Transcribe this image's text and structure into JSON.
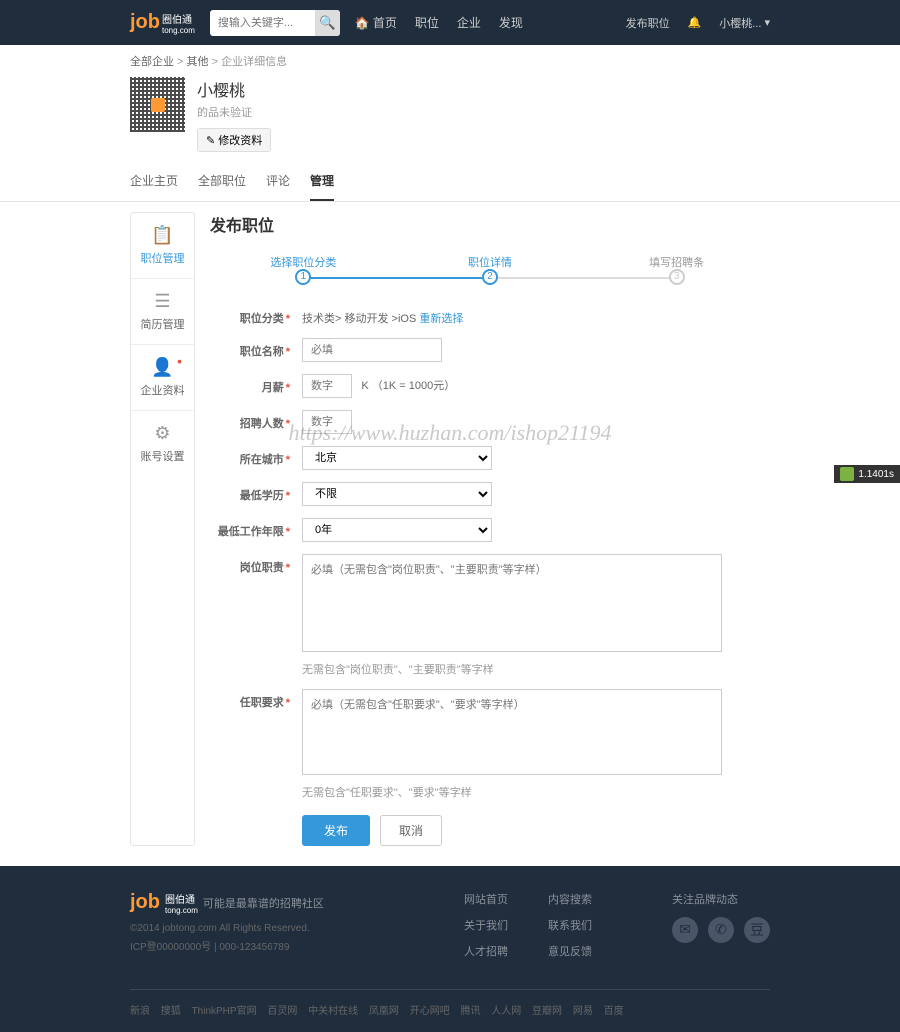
{
  "header": {
    "logo": "job",
    "logo_sub": "圈伯通",
    "logo_domain": "tong.com",
    "search_placeholder": "搜输入关键字...",
    "nav": [
      {
        "label": "首页"
      },
      {
        "label": "职位"
      },
      {
        "label": "企业"
      },
      {
        "label": "发现"
      }
    ],
    "right": {
      "publish": "发布职位",
      "username": "小樱桃..."
    }
  },
  "breadcrumb": {
    "items": [
      "全部企业",
      "其他"
    ],
    "current": "企业详细信息"
  },
  "profile": {
    "name": "小樱桃",
    "subtitle": "的品未验证",
    "edit_label": "修改资料"
  },
  "tabs": [
    {
      "label": "企业主页"
    },
    {
      "label": "全部职位"
    },
    {
      "label": "评论"
    },
    {
      "label": "管理",
      "active": true
    }
  ],
  "sidebar": [
    {
      "label": "职位管理",
      "icon": "📄",
      "active": true
    },
    {
      "label": "简历管理",
      "icon": "☰"
    },
    {
      "label": "企业资料",
      "icon": "👤",
      "dot": true
    },
    {
      "label": "账号设置",
      "icon": "⚙"
    }
  ],
  "content": {
    "title": "发布职位",
    "steps": [
      {
        "num": "1",
        "label": "选择职位分类"
      },
      {
        "num": "2",
        "label": "职位详情"
      },
      {
        "num": "3",
        "label": "填写招聘条",
        "inactive": true
      }
    ],
    "form": {
      "category_label": "职位分类",
      "category_value": "技术类> 移动开发 >iOS",
      "category_link": "重新选择",
      "name_label": "职位名称",
      "name_placeholder": "必填",
      "salary_label": "月薪",
      "salary_placeholder": "数字",
      "salary_unit": "K  （1K = 1000元）",
      "count_label": "招聘人数",
      "count_placeholder": "数字",
      "city_label": "所在城市",
      "city_value": "北京",
      "edu_label": "最低学历",
      "edu_value": "不限",
      "exp_label": "最低工作年限",
      "exp_value": "0年",
      "duty_label": "岗位职责",
      "duty_placeholder": "必填（无需包含\"岗位职责\"、\"主要职责\"等字样）",
      "duty_hint": "无需包含\"岗位职责\"、\"主要职责\"等字样",
      "req_label": "任职要求",
      "req_placeholder": "必填（无需包含\"任职要求\"、\"要求\"等字样）",
      "req_hint": "无需包含\"任职要求\"、\"要求\"等字样",
      "submit": "发布",
      "cancel": "取消"
    }
  },
  "footer": {
    "tagline": "可能是最靠谱的招聘社区",
    "copyright": "©2014 jobtong.com All Rights Reserved.",
    "icp": "ICP登00000000号 | 000-123456789",
    "links_col1": [
      "网站首页",
      "关于我们",
      "人才招聘"
    ],
    "links_col2": [
      "内容搜索",
      "联系我们",
      "意见反馈"
    ],
    "social_label": "关注品牌动态",
    "bottom_links": [
      "新浪",
      "搜狐",
      "ThinkPHP官网",
      "百灵网",
      "中关村在线",
      "凤凰网",
      "开心网吧",
      "腾讯",
      "人人网",
      "豆瓣网",
      "网易",
      "百度"
    ]
  },
  "watermark": "https://www.huzhan.com/ishop21194",
  "perf": "1.1401s"
}
